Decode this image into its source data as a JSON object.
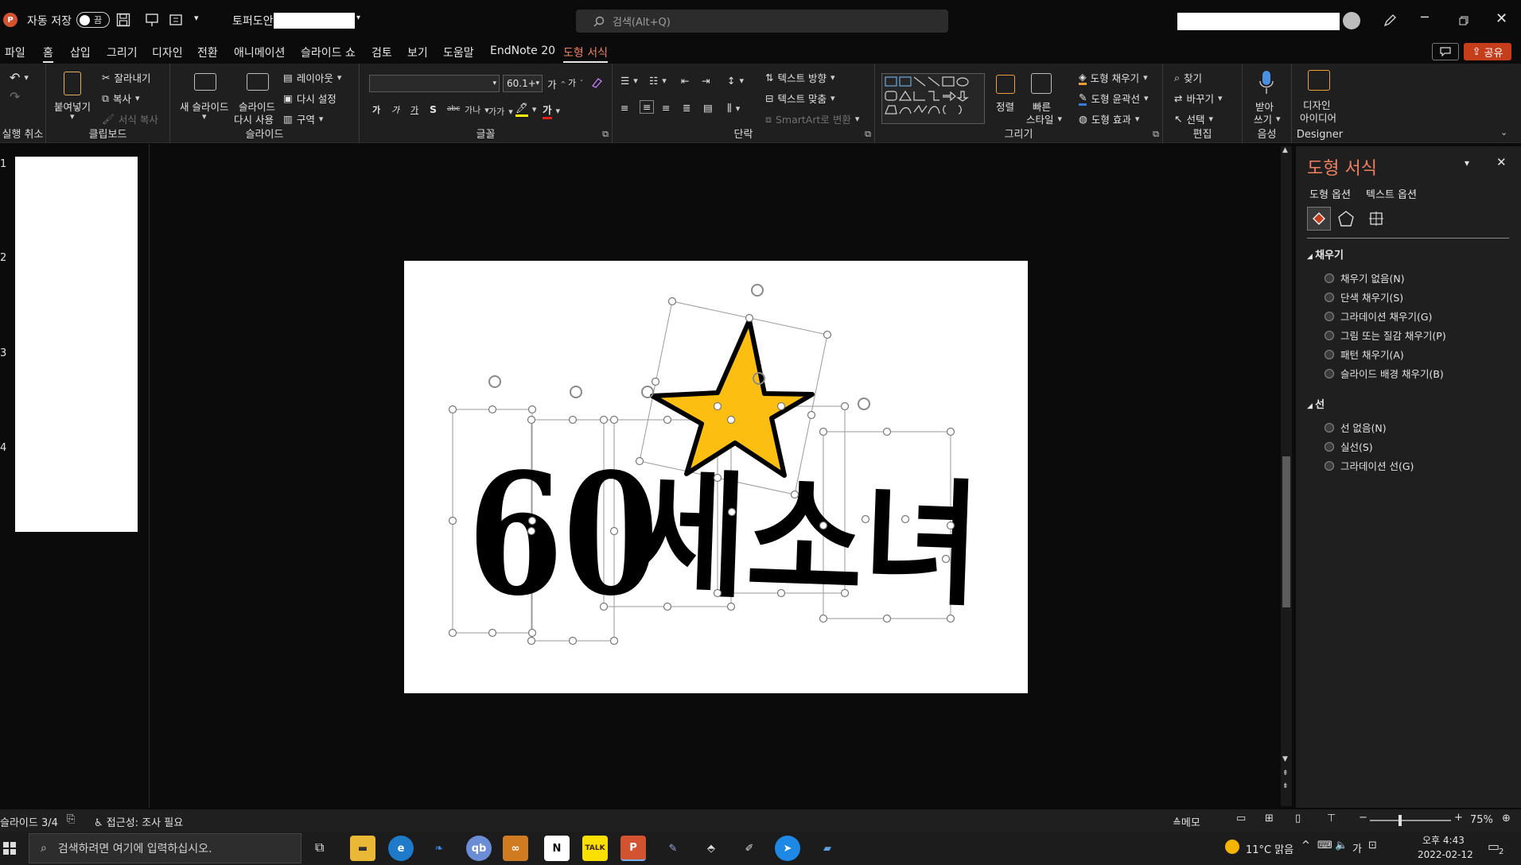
{
  "titlebar": {
    "autosave_label": "자동 저장",
    "autosave_state": "끔",
    "filename": "토퍼도안",
    "search_placeholder": "검색(Alt+Q)"
  },
  "tabs": [
    "파일",
    "홈",
    "삽입",
    "그리기",
    "디자인",
    "전환",
    "애니메이션",
    "슬라이드 쇼",
    "검토",
    "보기",
    "도움말",
    "EndNote 20",
    "도형 서식"
  ],
  "share_label": "공유",
  "ribbon": {
    "undo_label": "실행 취소",
    "clipboard": {
      "paste": "붙여넣기",
      "cut": "잘라내기",
      "copy": "복사",
      "format_painter": "서식 복사",
      "label": "클립보드"
    },
    "slides": {
      "new_slide": "새 슬라이드",
      "reuse_slide_1": "슬라이드",
      "reuse_slide_2": "다시 사용",
      "layout": "레이아웃",
      "reset": "다시 설정",
      "section": "구역",
      "label": "슬라이드"
    },
    "font": {
      "size": "60.1+",
      "grow": "가",
      "shrink": "가",
      "bold": "가",
      "italic": "가",
      "underline": "가",
      "strike": "S",
      "spacing": "가나",
      "case": "가가",
      "color_letter": "가",
      "label": "글꼴"
    },
    "paragraph": {
      "text_direction": "텍스트 방향",
      "align_text": "텍스트 맞춤",
      "smartart": "SmartArt로 변환",
      "label": "단락"
    },
    "drawing": {
      "arrange": "정렬",
      "quick_styles_1": "빠른",
      "quick_styles_2": "스타일",
      "shape_fill": "도형 채우기",
      "shape_outline": "도형 윤곽선",
      "shape_effects": "도형 효과",
      "label": "그리기"
    },
    "editing": {
      "find": "찾기",
      "replace": "바꾸기",
      "select": "선택",
      "label": "편집"
    },
    "voice": {
      "dictate_1": "받아",
      "dictate_2": "쓰기",
      "label": "음성"
    },
    "designer": {
      "ideas_1": "디자인",
      "ideas_2": "아이디어",
      "label": "Designer"
    }
  },
  "slides": [
    "1",
    "2",
    "3",
    "4"
  ],
  "slide_art": {
    "number_text": "60",
    "hangul_text": "세소녀",
    "star_color": "#FCBE11"
  },
  "pane": {
    "title": "도형 서식",
    "tab_shape": "도형 옵션",
    "tab_text": "텍스트 옵션",
    "fill_section": "채우기",
    "fill_options": [
      "채우기 없음(N)",
      "단색 채우기(S)",
      "그라데이션 채우기(G)",
      "그림 또는 질감 채우기(P)",
      "패턴 채우기(A)",
      "슬라이드 배경 채우기(B)"
    ],
    "line_section": "선",
    "line_options": [
      "선 없음(N)",
      "실선(S)",
      "그라데이션 선(G)"
    ]
  },
  "status": {
    "slide_info": "슬라이드 3/4",
    "accessibility": "접근성: 조사 필요",
    "notes": "메모",
    "zoom": "75%"
  },
  "taskbar": {
    "search_placeholder": "검색하려면 여기에 입력하십시오.",
    "weather": "11°C 맑음",
    "ime": "가",
    "time": "오후 4:43",
    "date": "2022-02-12",
    "notification_count": "2"
  },
  "colors": {
    "accent": "#F0805F",
    "share_button": "#C43E1C",
    "powerpoint": "#D35230"
  }
}
